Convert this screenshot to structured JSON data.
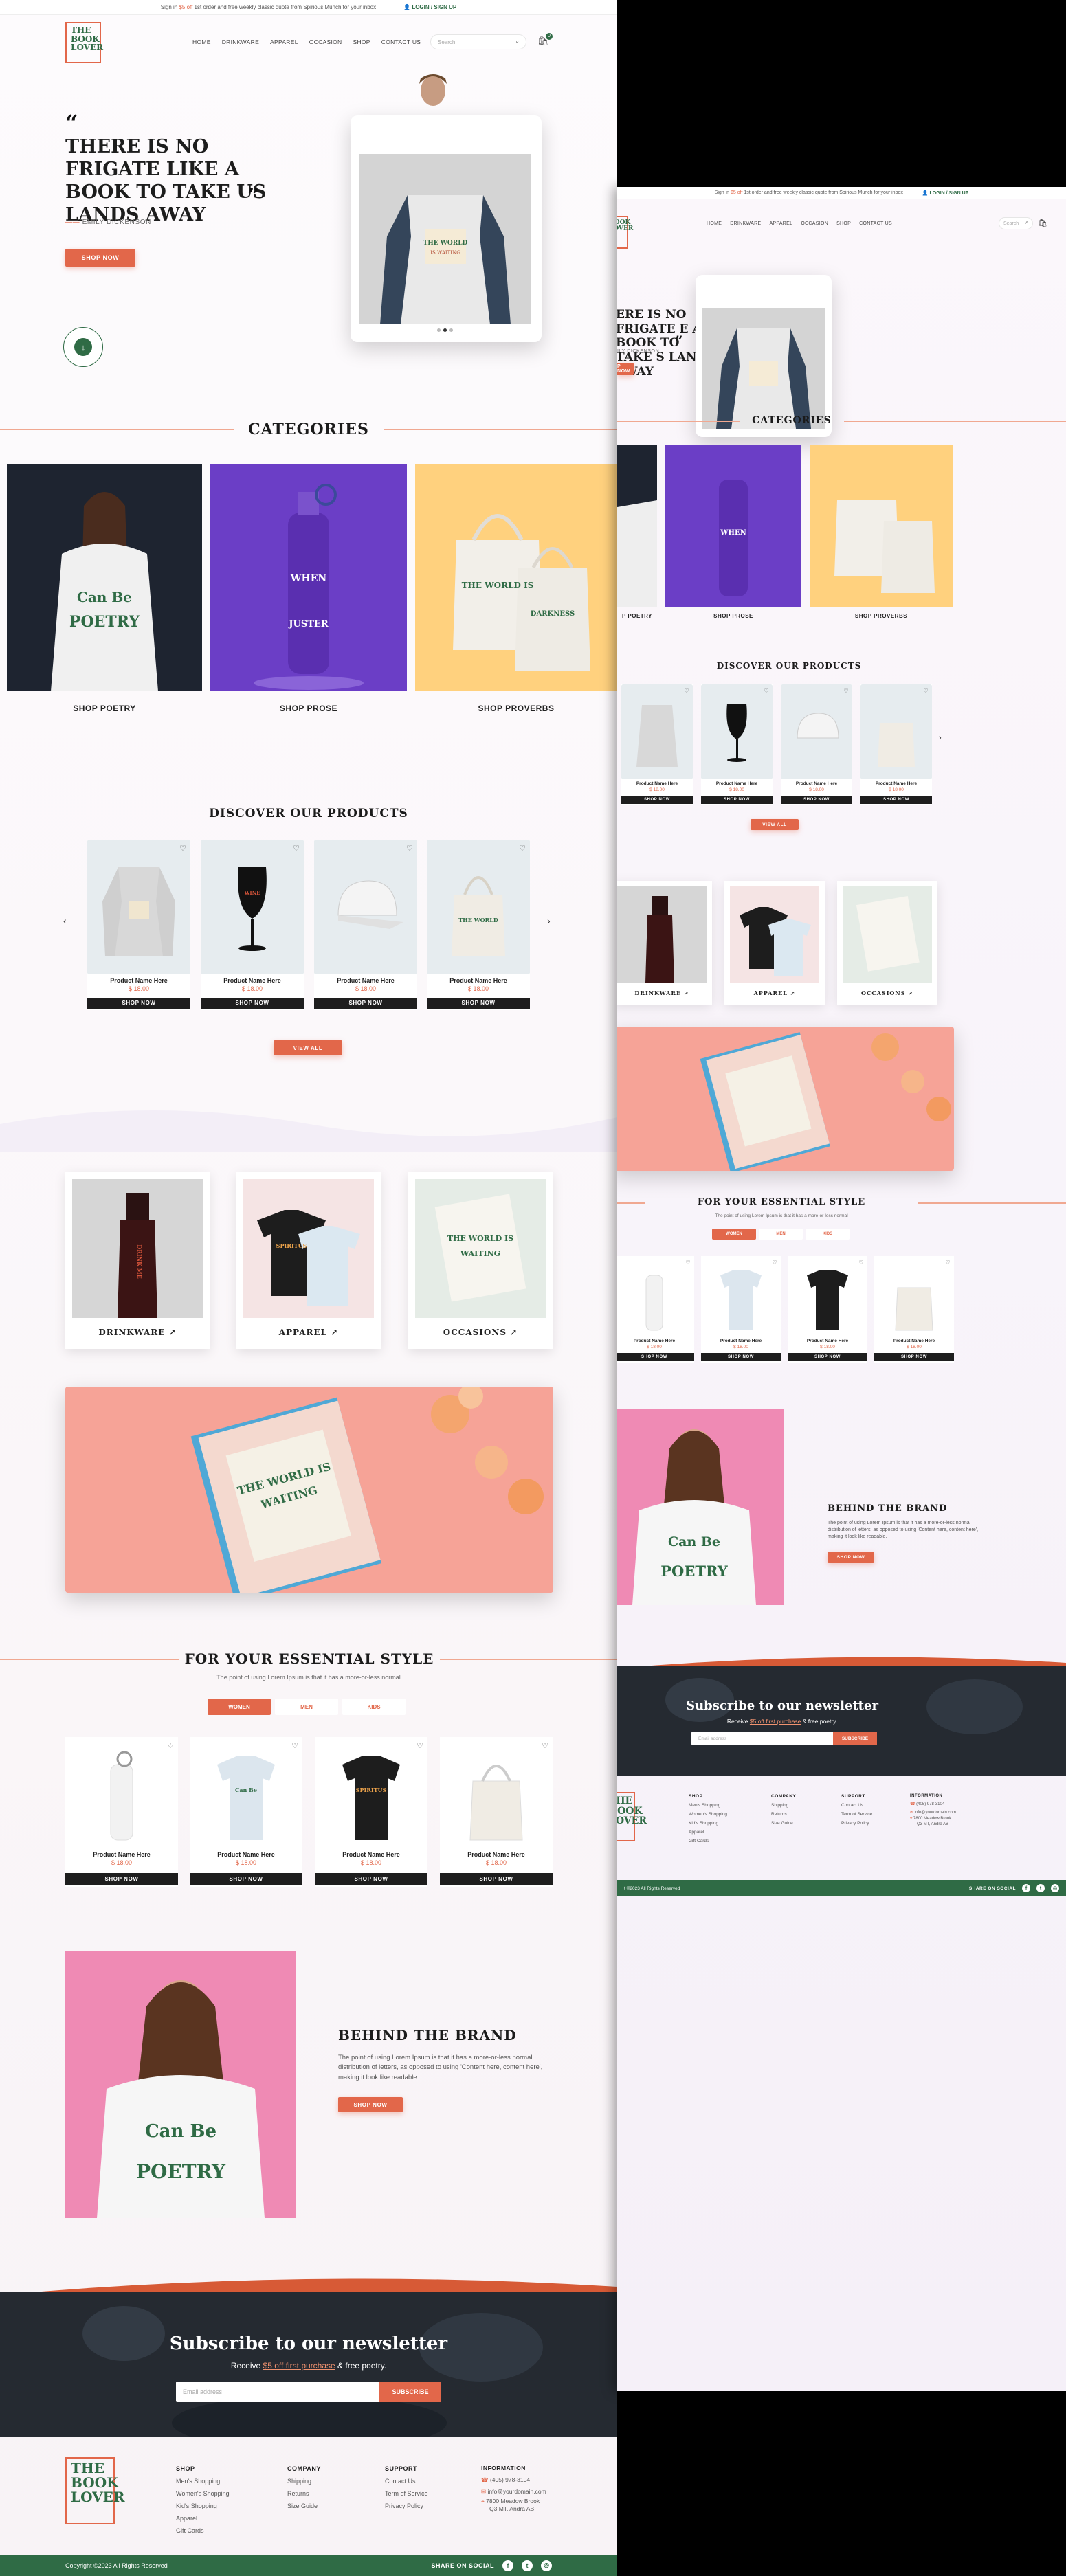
{
  "topbar": {
    "promo_prefix": "Sign in ",
    "promo_highlight": "$5 off",
    "promo_suffix": " 1st order and free weekly classic quote from Spirious Munch for your inbox",
    "login": "LOGIN / SIGN UP"
  },
  "logo": {
    "line1": "THE",
    "line2": "BOOK",
    "line3": "LOVER"
  },
  "nav": {
    "items": [
      "HOME",
      "DRINKWARE",
      "APPAREL",
      "OCCASION",
      "SHOP",
      "CONTACT US"
    ]
  },
  "search": {
    "placeholder": "Search"
  },
  "cart_count": "0",
  "hero": {
    "quote": "THERE IS NO FRIGATE LIKE A BOOK TO TAKE US LANDS AWAY",
    "quote_b": "ERE IS NO FRIGATE E A BOOK TO TAKE S LANDS AWAY",
    "author": "EMILY DICKENSON",
    "author_b": "ILY DICKENSON",
    "cta": "SHOP NOW",
    "cta_b": "P NOW",
    "badge_icon": "arrow-down-icon"
  },
  "categories": {
    "title": "CATEGORIES",
    "items": [
      "SHOP POETRY",
      "SHOP PROSE",
      "SHOP PROVERBS"
    ],
    "first_b": "P POETRY"
  },
  "discover": {
    "title": "DISCOVER OUR PRODUCTS",
    "products": [
      {
        "name": "Product Name Here",
        "price": "$ 18.00",
        "shop": "SHOP NOW"
      },
      {
        "name": "Product Name Here",
        "price": "$ 18.00",
        "shop": "SHOP NOW"
      },
      {
        "name": "Product Name Here",
        "price": "$ 18.00",
        "shop": "SHOP NOW"
      },
      {
        "name": "Product Name Here",
        "price": "$ 18.00",
        "shop": "SHOP NOW"
      }
    ],
    "view_all": "VIEW ALL"
  },
  "tiles": {
    "items": [
      "DRINKWARE ↗",
      "APPAREL ↗",
      "OCCASIONS ↗"
    ]
  },
  "essential": {
    "title": "FOR YOUR ESSENTIAL STYLE",
    "subtitle": "The point of using Lorem Ipsum is that it has a more-or-less normal",
    "tabs": [
      "WOMEN",
      "MEN",
      "KIDS"
    ],
    "products": [
      {
        "name": "Product Name Here",
        "price": "$ 18.00",
        "shop": "SHOP NOW"
      },
      {
        "name": "Product Name Here",
        "price": "$ 18.00",
        "shop": "SHOP NOW"
      },
      {
        "name": "Product Name Here",
        "price": "$ 18.00",
        "shop": "SHOP NOW"
      },
      {
        "name": "Product Name Here",
        "price": "$ 18.00",
        "shop": "SHOP NOW"
      }
    ]
  },
  "brand": {
    "title": "BEHIND THE BRAND",
    "body": "The point of using Lorem Ipsum is that it has a more-or-less normal distribution of letters, as opposed to using 'Content here, content here', making it look like readable.",
    "cta": "SHOP NOW"
  },
  "newsletter": {
    "title": "Subscribe to our newsletter",
    "subtitle_prefix": "Receive ",
    "subtitle_highlight": "$5 off first purchase",
    "subtitle_suffix": " & free poetry.",
    "placeholder": "Email address",
    "button": "SUBSCRIBE"
  },
  "footer": {
    "shop": {
      "heading": "SHOP",
      "links": [
        "Men's Shopping",
        "Women's Shopping",
        "Kid's Shopping",
        "Apparel",
        "Gift Cards"
      ]
    },
    "company": {
      "heading": "COMPANY",
      "links": [
        "Shipping",
        "Returns",
        "Size Guide"
      ]
    },
    "support": {
      "heading": "SUPPORT",
      "links": [
        "Contact Us",
        "Term of Service",
        "Privacy Policy"
      ]
    },
    "info": {
      "heading": "INFORMATION",
      "phone": "(405) 978-3104",
      "email": "info@yourdomain.com",
      "address_line1": "7800 Meadow Brook",
      "address_line2": "Q3 MT, Andra AB"
    },
    "copyright": "Copyright ©2023 All Rights Reserved",
    "copyright_b": "t ©2023 All Rights Reserved",
    "share": "SHARE ON SOCIAL",
    "social_icons": [
      "facebook-icon",
      "twitter-icon",
      "instagram-icon"
    ],
    "social_glyphs": [
      "f",
      "t",
      "◎"
    ]
  },
  "colors": {
    "accent": "#e2674a",
    "brand_green": "#2f6b45",
    "dark": "#1e1e1e"
  }
}
